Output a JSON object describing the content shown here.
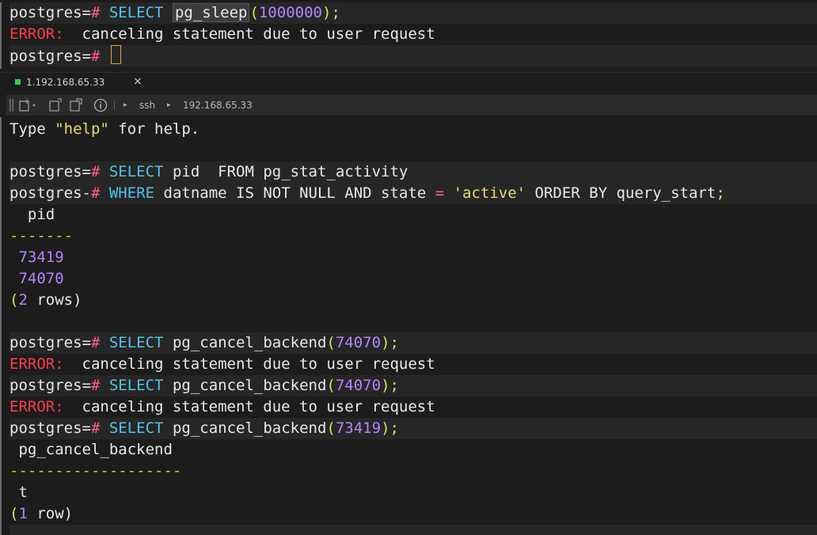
{
  "top_terminal": {
    "line1": {
      "prompt": "postgres=",
      "op": "#",
      "kw": "SELECT",
      "fn": "pg_sleep",
      "open": "(",
      "num": "1000000",
      "close": ");"
    },
    "line2": {
      "err": "ERROR:",
      "msg": "  canceling statement due to user request"
    },
    "line3": {
      "prompt": "postgres=",
      "op": "#"
    }
  },
  "tab": {
    "label": "1.192.168.65.33",
    "close": "×"
  },
  "toolbar": {
    "sep": "▸",
    "ssh": "ssh",
    "host": "192.168.65.33",
    "info": "i"
  },
  "bottom_terminal": {
    "help": {
      "pre": "Type ",
      "q": "\"help\"",
      "post": " for help."
    },
    "q1a": {
      "prompt": "postgres=",
      "op": "#",
      "kw": "SELECT",
      "rest": " pid  FROM pg_stat_activity"
    },
    "q1b": {
      "prompt": "postgres-",
      "op": "#",
      "kw": "WHERE",
      "mid": " datname IS NOT NULL AND state ",
      "eq": "=",
      "str": "'active'",
      "tail": " ORDER BY query_start",
      "semi": ";"
    },
    "col_pid": "  pid",
    "dash1": "-------",
    "row1": " 73419",
    "row2": " 74070",
    "rows2": {
      "open": "(",
      "n": "2",
      "text": " rows)"
    },
    "c1": {
      "prompt": "postgres=",
      "op": "#",
      "kw": "SELECT",
      "fn": " pg_cancel_backend",
      "open": "(",
      "num": "74070",
      "close": ");"
    },
    "e1": {
      "err": "ERROR:",
      "msg": "  canceling statement due to user request"
    },
    "c2": {
      "prompt": "postgres=",
      "op": "#",
      "kw": "SELECT",
      "fn": " pg_cancel_backend",
      "open": "(",
      "num": "74070",
      "close": ");"
    },
    "e2": {
      "err": "ERROR:",
      "msg": "  canceling statement due to user request"
    },
    "c3": {
      "prompt": "postgres=",
      "op": "#",
      "kw": "SELECT",
      "fn": " pg_cancel_backend",
      "open": "(",
      "num": "73419",
      "close": ");"
    },
    "col_cancel": " pg_cancel_backend",
    "dash2": "-------------------",
    "val_t": " t",
    "rows1": {
      "open": "(",
      "n": "1",
      "text": " row)"
    }
  },
  "colors": {
    "keyword": "#4fc4e8",
    "number": "#b483ff",
    "error": "#ff3b4a",
    "string": "#e3dd6a",
    "dash": "#a6e22e",
    "prompt_hash": "#ff5a8a"
  }
}
